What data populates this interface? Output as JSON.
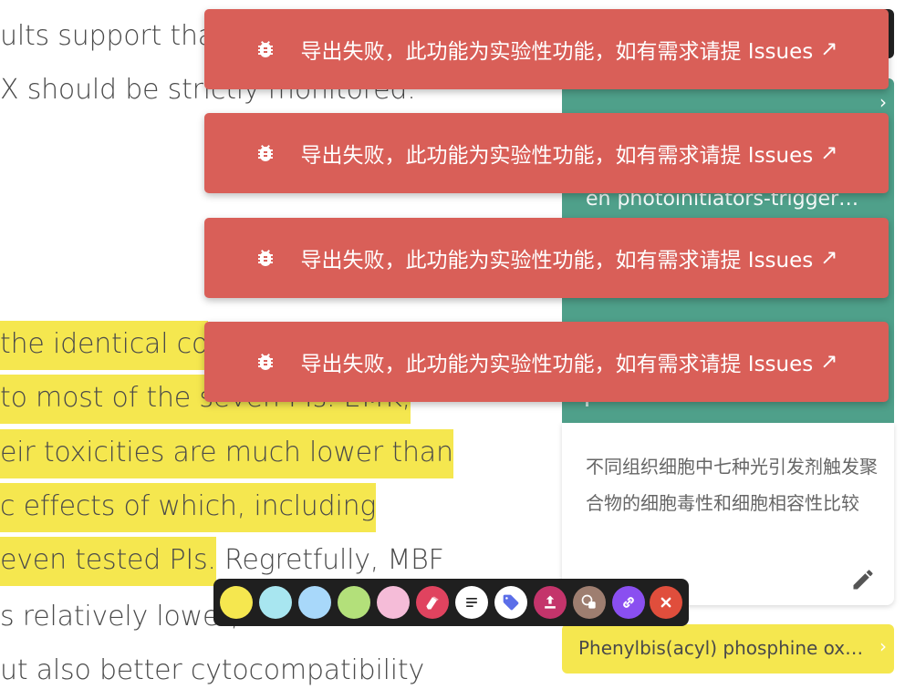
{
  "document": {
    "lines": [
      "ults support that",
      "X should be strictly monitored.",
      "the identical co",
      "to most of the seven PIs. EMK,",
      "eir toxicities are much lower than",
      "c effects of which, including",
      "even tested PIs.",
      " Regretfully, MBF",
      "s relatively lower, which leads to",
      "ut also better cytocompatibility"
    ]
  },
  "panel": {
    "teal_card": {
      "lines": [
        "en photoinitiators-trigger…"
      ]
    },
    "note_text": "不同组织细胞中七种光引发剂触发聚合物的细胞毒性和细胞相容性比较",
    "yellow_card_text": "Phenylbis(acyl) phosphine ox…"
  },
  "toasts": [
    {
      "message": "导出失败，此功能为实验性功能，如有需求请提 Issues",
      "link_icon": "↗"
    },
    {
      "message": "导出失败，此功能为实验性功能，如有需求请提 Issues",
      "link_icon": "↗"
    },
    {
      "message": "导出失败，此功能为实验性功能，如有需求请提 Issues",
      "link_icon": "↗"
    },
    {
      "message": "导出失败，此功能为实验性功能，如有需求请提 Issues",
      "link_icon": "↗"
    }
  ],
  "toolbar": {
    "colors": [
      "#f5e74f",
      "#a8e6f0",
      "#a8d8fa",
      "#b3e07a",
      "#f5bcd8"
    ],
    "actions": [
      "eraser-icon",
      "notes-icon",
      "tag-icon",
      "export-icon",
      "copy-icon",
      "link-icon",
      "close-icon"
    ],
    "action_colors": [
      "#e0435f",
      "#ffffff",
      "#ffffff",
      "#c4346b",
      "#9e7e70",
      "#8a4ff0",
      "#e04e3c"
    ]
  }
}
